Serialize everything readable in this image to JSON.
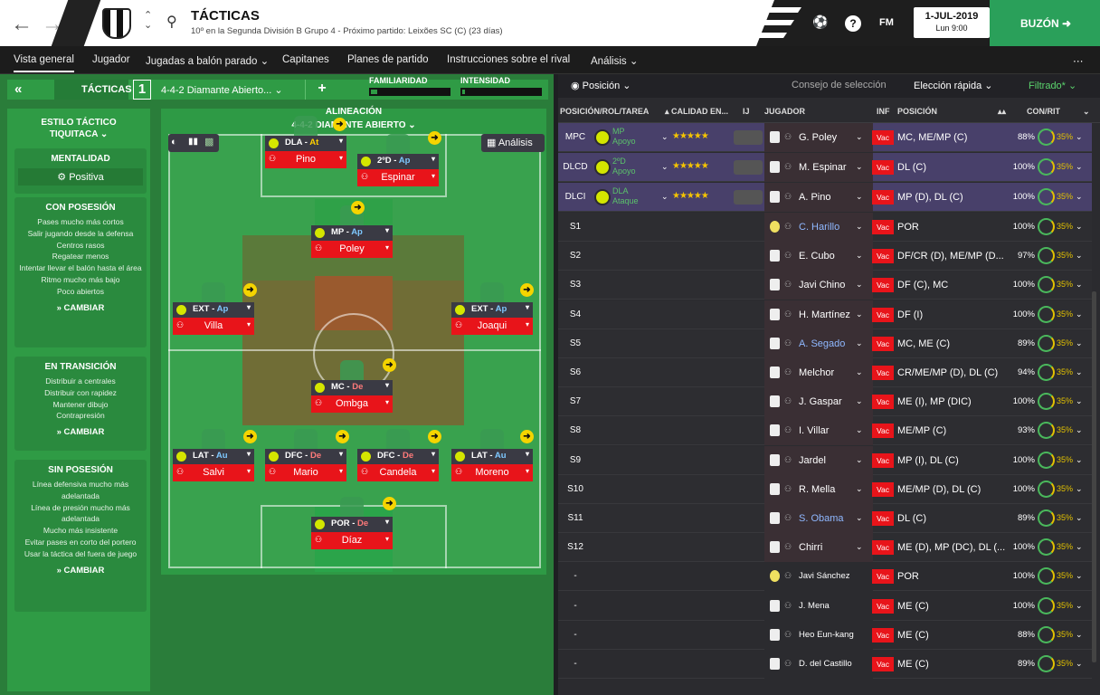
{
  "header": {
    "title": "TÁCTICAS",
    "subtitle": "10º en la Segunda División B Grupo 4 - Próximo partido: Leixões SC (C)  (23 días)",
    "fm": "FM",
    "date": "1-JUL-2019",
    "time": "Lun 9:00",
    "buzon": "BUZÓN",
    "help": "?"
  },
  "menu": [
    "Vista general",
    "Jugador",
    "Jugadas a balón parado ⌄",
    "Capitanes",
    "Planes de partido",
    "Instrucciones sobre el rival",
    "Análisis ⌄"
  ],
  "tacticbar": {
    "back": "«",
    "tacticas": "TÁCTICAS",
    "slot": "1",
    "formation": "4-4-2 Diamante Abierto...",
    "plus": "+",
    "familiaridad": "FAMILIARIDAD",
    "intensidad": "INTENSIDAD",
    "familiaridad_level": 0.12,
    "intensidad_level": 0.08
  },
  "style": {
    "estilo_label": "ESTILO TÁCTICO",
    "estilo": "TIQUITACA ⌄",
    "mentalidad_label": "MENTALIDAD",
    "mentalidad": "Positiva",
    "con_posesion": "CON POSESIÓN",
    "con_posesion_items": [
      "Pases mucho más cortos",
      "Salir jugando desde la defensa",
      "Centros rasos",
      "Regatear menos",
      "Intentar llevar el balón hasta el área",
      "Ritmo mucho más bajo",
      "Poco abiertos"
    ],
    "transicion": "EN TRANSICIÓN",
    "transicion_items": [
      "Distribuir a centrales",
      "Distribuir con rapidez",
      "Mantener dibujo",
      "Contrapresión"
    ],
    "sin_posesion": "SIN POSESIÓN",
    "sin_posesion_items": [
      "Línea defensiva mucho más adelantada",
      "Línea de presión mucho más adelantada",
      "Mucho más insistente",
      "Evitar pases en corto del portero",
      "Usar la táctica del fuera de juego"
    ],
    "cambiar": "CAMBIAR"
  },
  "pitch": {
    "alineacion": "ALINEACIÓN",
    "formation": "4-4-2 DIAMANTE ABIERTO ⌄",
    "analisis": "Análisis",
    "players": [
      {
        "role": "DLA",
        "duty": "At",
        "name": "Pino"
      },
      {
        "role": "2ºD",
        "duty": "Ap",
        "name": "Espinar"
      },
      {
        "role": "MP",
        "duty": "Ap",
        "name": "Poley"
      },
      {
        "role": "EXT",
        "duty": "Ap",
        "name": "Villa"
      },
      {
        "role": "EXT",
        "duty": "Ap",
        "name": "Joaqui"
      },
      {
        "role": "MC",
        "duty": "De",
        "name": "Ombga"
      },
      {
        "role": "LAT",
        "duty": "Au",
        "name": "Salvi"
      },
      {
        "role": "DFC",
        "duty": "De",
        "name": "Mario"
      },
      {
        "role": "DFC",
        "duty": "De",
        "name": "Candela"
      },
      {
        "role": "LAT",
        "duty": "Au",
        "name": "Moreno"
      },
      {
        "role": "POR",
        "duty": "De",
        "name": "Díaz"
      }
    ]
  },
  "right": {
    "posicion": "Posición ⌄",
    "consejo": "Consejo de selección",
    "eleccion": "Elección rápida ⌄",
    "filtrado": "Filtrado* ⌄",
    "headers": [
      "POSICIÓN/ROL/TAREA",
      "▴ CALIDAD EN...",
      "IJ",
      "JUGADOR",
      "INF",
      "POSICIÓN",
      "▴▴",
      "CON/RIT"
    ],
    "rows": [
      {
        "slot": "MPC",
        "role": "MP",
        "duty": "Apoyo",
        "stars": "★★★★★",
        "player": "G. Poley",
        "vac": "Vac",
        "pos": "MC, ME/MP (C)",
        "pct": "88%",
        "rit": "35%"
      },
      {
        "slot": "DLCD",
        "role": "2ºD",
        "duty": "Apoyo",
        "stars": "★★★★★",
        "player": "M. Espinar",
        "vac": "Vac",
        "pos": "DL (C)",
        "pct": "100%",
        "rit": "35%"
      },
      {
        "slot": "DLCI",
        "role": "DLA",
        "duty": "Ataque",
        "stars": "★★★★★",
        "player": "A. Pino",
        "vac": "Vac",
        "pos": "MP (D), DL (C)",
        "pct": "100%",
        "rit": "35%"
      },
      {
        "slot": "S1",
        "player": "C. Harillo",
        "vac": "Vac",
        "pos": "POR",
        "pct": "100%",
        "rit": "35%"
      },
      {
        "slot": "S2",
        "player": "E. Cubo",
        "vac": "Vac",
        "pos": "DF/CR (D), ME/MP (D...",
        "pct": "97%",
        "rit": "35%"
      },
      {
        "slot": "S3",
        "player": "Javi Chino",
        "vac": "Vac",
        "pos": "DF (C), MC",
        "pct": "100%",
        "rit": "35%"
      },
      {
        "slot": "S4",
        "player": "H. Martínez",
        "vac": "Vac",
        "pos": "DF (I)",
        "pct": "100%",
        "rit": "35%"
      },
      {
        "slot": "S5",
        "player": "A. Segado",
        "vac": "Vac",
        "pos": "MC, ME (C)",
        "pct": "89%",
        "rit": "35%"
      },
      {
        "slot": "S6",
        "player": "Melchor",
        "vac": "Vac",
        "pos": "CR/ME/MP (D), DL (C)",
        "pct": "94%",
        "rit": "35%"
      },
      {
        "slot": "S7",
        "player": "J. Gaspar",
        "vac": "Vac",
        "pos": "ME (I), MP (DIC)",
        "pct": "100%",
        "rit": "35%"
      },
      {
        "slot": "S8",
        "player": "I. Villar",
        "vac": "Vac",
        "pos": "ME/MP (C)",
        "pct": "93%",
        "rit": "35%"
      },
      {
        "slot": "S9",
        "player": "Jardel",
        "vac": "Vac",
        "pos": "MP (I), DL (C)",
        "pct": "100%",
        "rit": "35%"
      },
      {
        "slot": "S10",
        "player": "R. Mella",
        "vac": "Vac",
        "pos": "ME/MP (D), DL (C)",
        "pct": "100%",
        "rit": "35%"
      },
      {
        "slot": "S11",
        "player": "S. Obama",
        "vac": "Vac",
        "pos": "DL (C)",
        "pct": "89%",
        "rit": "35%"
      },
      {
        "slot": "S12",
        "player": "Chirri",
        "vac": "Vac",
        "pos": "ME (D), MP (DC), DL (...",
        "pct": "100%",
        "rit": "35%"
      },
      {
        "slot": "-",
        "player": "Javi Sánchez",
        "vac": "Vac",
        "pos": "POR",
        "pct": "100%",
        "rit": "35%"
      },
      {
        "slot": "-",
        "player": "J. Mena",
        "vac": "Vac",
        "pos": "ME (C)",
        "pct": "100%",
        "rit": "35%"
      },
      {
        "slot": "-",
        "player": "Heo Eun-kang",
        "vac": "Vac",
        "pos": "ME (C)",
        "pct": "88%",
        "rit": "35%"
      },
      {
        "slot": "-",
        "player": "D. del Castillo",
        "vac": "Vac",
        "pos": "ME (C)",
        "pct": "89%",
        "rit": "35%"
      }
    ]
  }
}
